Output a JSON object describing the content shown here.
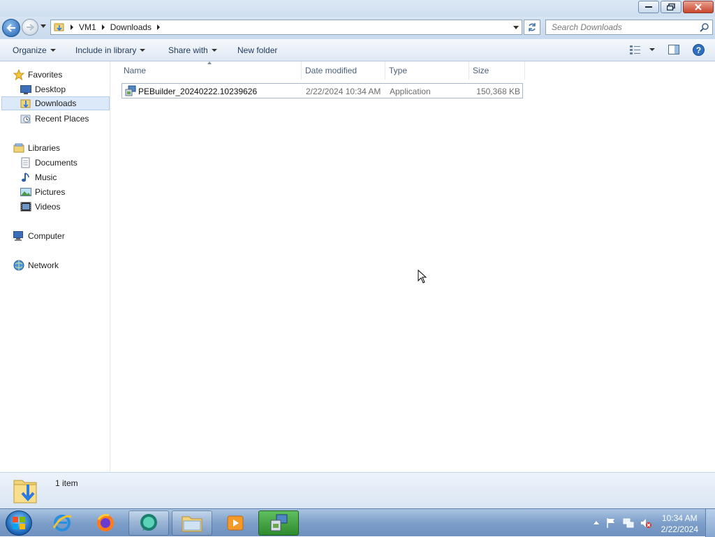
{
  "window": {
    "buttons": {
      "minimize": "minimize",
      "maximize": "restore",
      "close": "close"
    }
  },
  "address": {
    "breadcrumbs": [
      "VM1",
      "Downloads"
    ],
    "search_placeholder": "Search Downloads"
  },
  "toolbar": {
    "organize": "Organize",
    "include_in_library": "Include in library",
    "share_with": "Share with",
    "new_folder": "New folder"
  },
  "sidebar": {
    "favorites": {
      "label": "Favorites",
      "items": [
        {
          "label": "Desktop",
          "icon": "desktop-icon"
        },
        {
          "label": "Downloads",
          "icon": "downloads-folder-icon",
          "selected": true
        },
        {
          "label": "Recent Places",
          "icon": "recent-places-icon"
        }
      ]
    },
    "libraries": {
      "label": "Libraries",
      "items": [
        {
          "label": "Documents",
          "icon": "documents-icon"
        },
        {
          "label": "Music",
          "icon": "music-icon"
        },
        {
          "label": "Pictures",
          "icon": "pictures-icon"
        },
        {
          "label": "Videos",
          "icon": "videos-icon"
        }
      ]
    },
    "computer": {
      "label": "Computer"
    },
    "network": {
      "label": "Network"
    }
  },
  "file_list": {
    "columns": [
      "Name",
      "Date modified",
      "Type",
      "Size"
    ],
    "rows": [
      {
        "name": "PEBuilder_20240222.10239626",
        "date_modified": "2/22/2024 10:34 AM",
        "type": "Application",
        "size": "150,368 KB"
      }
    ]
  },
  "details": {
    "item_count": "1 item"
  },
  "taskbar": {
    "clock_time": "10:34 AM",
    "clock_date": "2/22/2024"
  },
  "colors": {
    "accent": "#1f5fae",
    "selection": "#dbe9f8",
    "taskbar": "#7d9fc9"
  }
}
